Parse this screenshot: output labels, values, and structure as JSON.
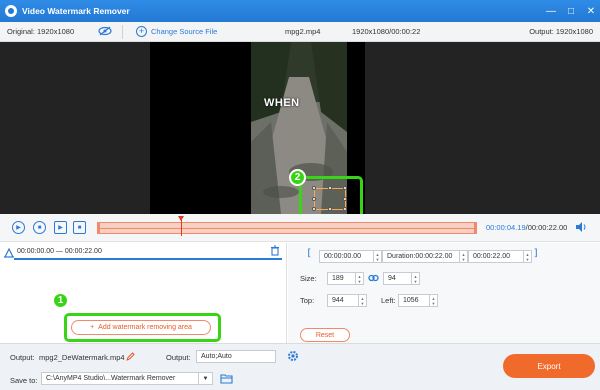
{
  "titlebar": {
    "title": "Video Watermark Remover",
    "controls": [
      "minimize",
      "maximize",
      "close"
    ]
  },
  "infobar": {
    "original": "Original: 1920x1080",
    "change_source": "Change Source File",
    "filename": "mpg2.mp4",
    "file_info": "1920x1080/00:00:22",
    "output": "Output: 1920x1080"
  },
  "video": {
    "overlay_text": "WHEN"
  },
  "badges": {
    "one": "1",
    "two": "2"
  },
  "playback": {
    "current_time": "00:00:04.19",
    "total_time": "/00:00:22.00",
    "position": 0.19
  },
  "segment": {
    "range": "00:00:00.00 — 00:00:22.00"
  },
  "add_button": {
    "label": "Add watermark removing area"
  },
  "params": {
    "start": "00:00:00.00",
    "duration_label": "Duration:",
    "duration": "00:00:22.00",
    "end": "00:00:22.00",
    "size_label": "Size:",
    "width": "189",
    "height": "94",
    "top_label": "Top:",
    "top": "944",
    "left_label": "Left:",
    "left": "1056",
    "reset": "Reset"
  },
  "bottom": {
    "output_label": "Output:",
    "output_name": "mpg2_DeWatermark.mp4",
    "output_format_label": "Output:",
    "output_format": "Auto;Auto",
    "save_label": "Save to:",
    "save_path": "C:\\AnyMP4 Studio\\...Watermark Remover",
    "export": "Export"
  }
}
